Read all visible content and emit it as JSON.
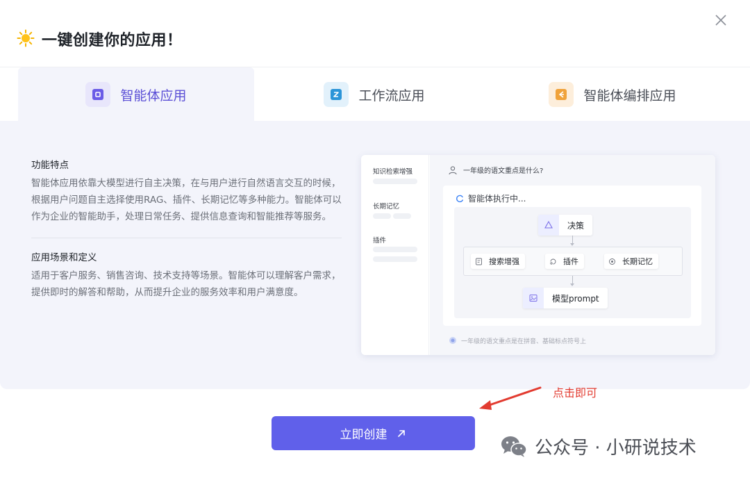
{
  "header": {
    "title": "一键创建你的应用！"
  },
  "tabs": [
    {
      "label": "智能体应用",
      "active": true,
      "icon": "agent-icon",
      "color": "#5b4fd6"
    },
    {
      "label": "工作流应用",
      "active": false,
      "icon": "workflow-icon",
      "color": "#2c95d8"
    },
    {
      "label": "智能体编排应用",
      "active": false,
      "icon": "orchestration-icon",
      "color": "#f0a23a"
    }
  ],
  "description": {
    "features_title": "功能特点",
    "features_body": "智能体应用依靠大模型进行自主决策，在与用户进行自然语言交互的时候，根据用户问题自主选择使用RAG、插件、长期记忆等多种能力。智能体可以作为企业的智能助手，处理日常任务、提供信息查询和智能推荐等服务。",
    "scenarios_title": "应用场景和定义",
    "scenarios_body": "适用于客户服务、销售咨询、技术支持等场景。智能体可以理解客户需求，提供即时的解答和帮助，从而提升企业的服务效率和用户满意度。"
  },
  "preview": {
    "sidebar": [
      "知识检索增强",
      "长期记忆",
      "插件"
    ],
    "question": "一年级的语文重点是什么?",
    "exec_title": "智能体执行中...",
    "nodes": {
      "decision": "决策",
      "search": "搜索增强",
      "plugin": "插件",
      "memory": "长期记忆",
      "model": "模型prompt"
    },
    "bottom_text": "一年级的语文重点是在拼音、基础标点符号上"
  },
  "annotation": {
    "text": "点击即可",
    "color": "#e23b30"
  },
  "create_button": {
    "label": "立即创建",
    "color": "#6060ea"
  },
  "watermark": {
    "text": "公众号 · 小研说技术"
  }
}
